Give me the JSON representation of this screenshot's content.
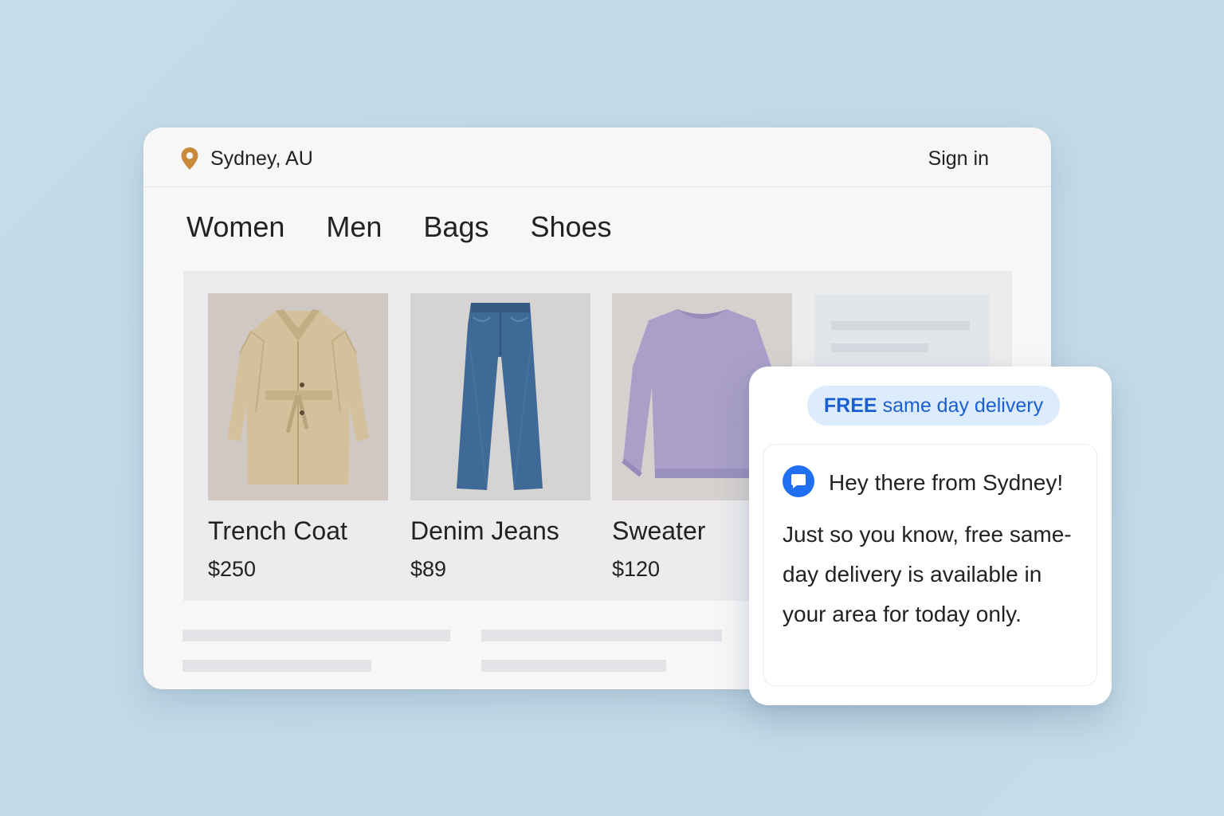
{
  "header": {
    "location": "Sydney, AU",
    "sign_in": "Sign in"
  },
  "nav": {
    "items": [
      {
        "label": "Women"
      },
      {
        "label": "Men"
      },
      {
        "label": "Bags"
      },
      {
        "label": "Shoes"
      }
    ]
  },
  "products": [
    {
      "name": "Trench Coat",
      "price": "$250",
      "icon": "trench-coat-icon"
    },
    {
      "name": "Denim Jeans",
      "price": "$89",
      "icon": "jeans-icon"
    },
    {
      "name": "Sweater",
      "price": "$120",
      "icon": "sweater-icon"
    }
  ],
  "notification": {
    "badge_strong": "FREE",
    "badge_rest": "same day delivery",
    "heading": "Hey there from Sydney!",
    "body": "Just so you know, free same-day delivery is available in your area for today only."
  },
  "colors": {
    "accent_blue": "#1a5fd0",
    "pin_orange": "#c98a3c",
    "badge_bg": "#dcecfc",
    "chat_icon_blue": "#1f6ff0"
  }
}
